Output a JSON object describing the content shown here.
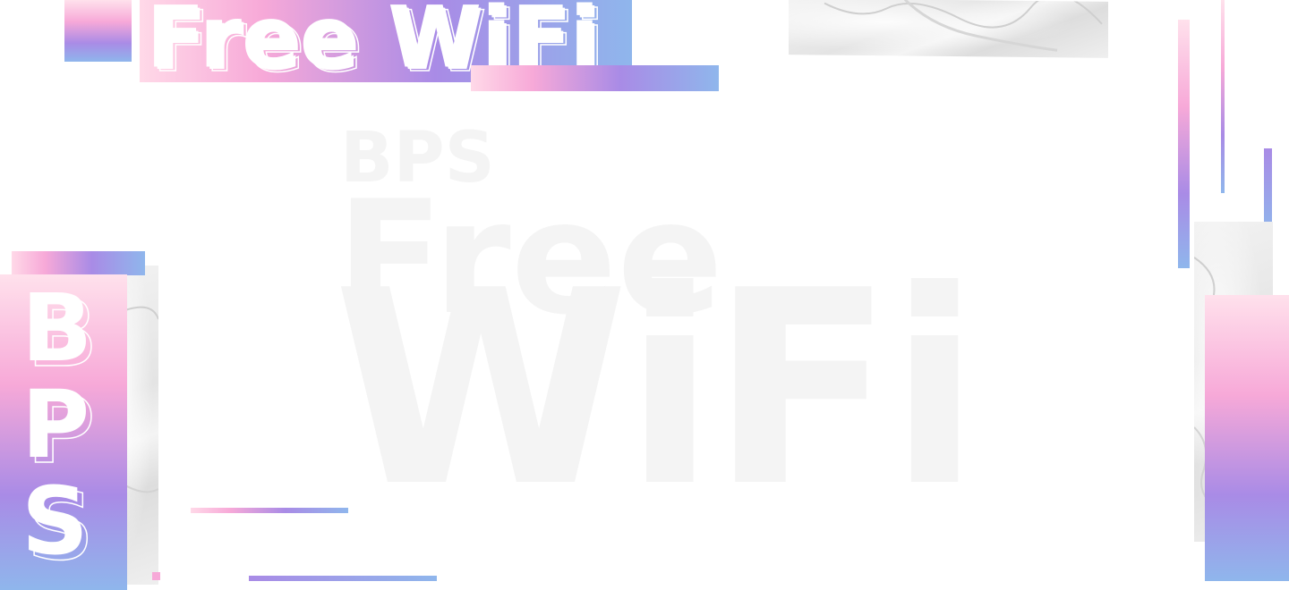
{
  "header": {
    "title": "Free WiFi"
  },
  "side_label": {
    "letters": [
      "B",
      "P",
      "S"
    ]
  },
  "watermark": {
    "line1": "BPS",
    "line2": "Free",
    "line3": "WiFi"
  },
  "colors": {
    "pink_light": "#ffd9e8",
    "pink": "#f7a9d8",
    "purple": "#a98be6",
    "blue": "#8fb6ec",
    "watermark": "#f4f4f4",
    "background": "#ffffff"
  }
}
